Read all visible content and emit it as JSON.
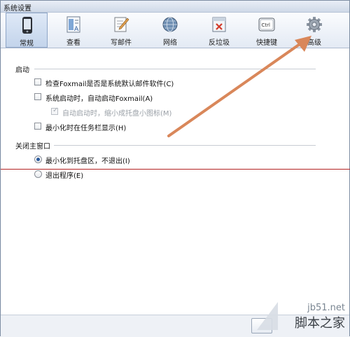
{
  "window": {
    "title": "系统设置"
  },
  "toolbar": {
    "items": [
      {
        "label": "常规",
        "icon": "phone-icon",
        "active": true
      },
      {
        "label": "查看",
        "icon": "view-icon",
        "active": false
      },
      {
        "label": "写邮件",
        "icon": "compose-icon",
        "active": false
      },
      {
        "label": "网络",
        "icon": "globe-icon",
        "active": false
      },
      {
        "label": "反垃圾",
        "icon": "antispam-icon",
        "active": false
      },
      {
        "label": "快捷键",
        "icon": "keyboard-ctrl-icon",
        "active": false
      },
      {
        "label": "高级",
        "icon": "gear-icon",
        "active": false
      }
    ],
    "ctrl_text": "Ctrl"
  },
  "startup": {
    "header": "启动",
    "options": [
      {
        "label": "检查Foxmail是否是系统默认邮件软件(C)",
        "checked": false,
        "disabled": false
      },
      {
        "label": "系统启动时，自动启动Foxmail(A)",
        "checked": false,
        "disabled": false
      },
      {
        "label": "自动启动时，缩小成托盘小图标(M)",
        "checked": true,
        "disabled": true
      },
      {
        "label": "最小化时在任务栏显示(H)",
        "checked": false,
        "disabled": false
      }
    ]
  },
  "close_main": {
    "header": "关闭主窗口",
    "options": [
      {
        "label": "最小化到托盘区，不退出(I)",
        "selected": true
      },
      {
        "label": "退出程序(E)",
        "selected": false
      }
    ]
  },
  "watermark": {
    "site": "jb51.net",
    "name": "脚本之家"
  },
  "colors": {
    "arrow": "#d9875a",
    "redline": "#b32222",
    "accent": "#2a5a9c"
  }
}
